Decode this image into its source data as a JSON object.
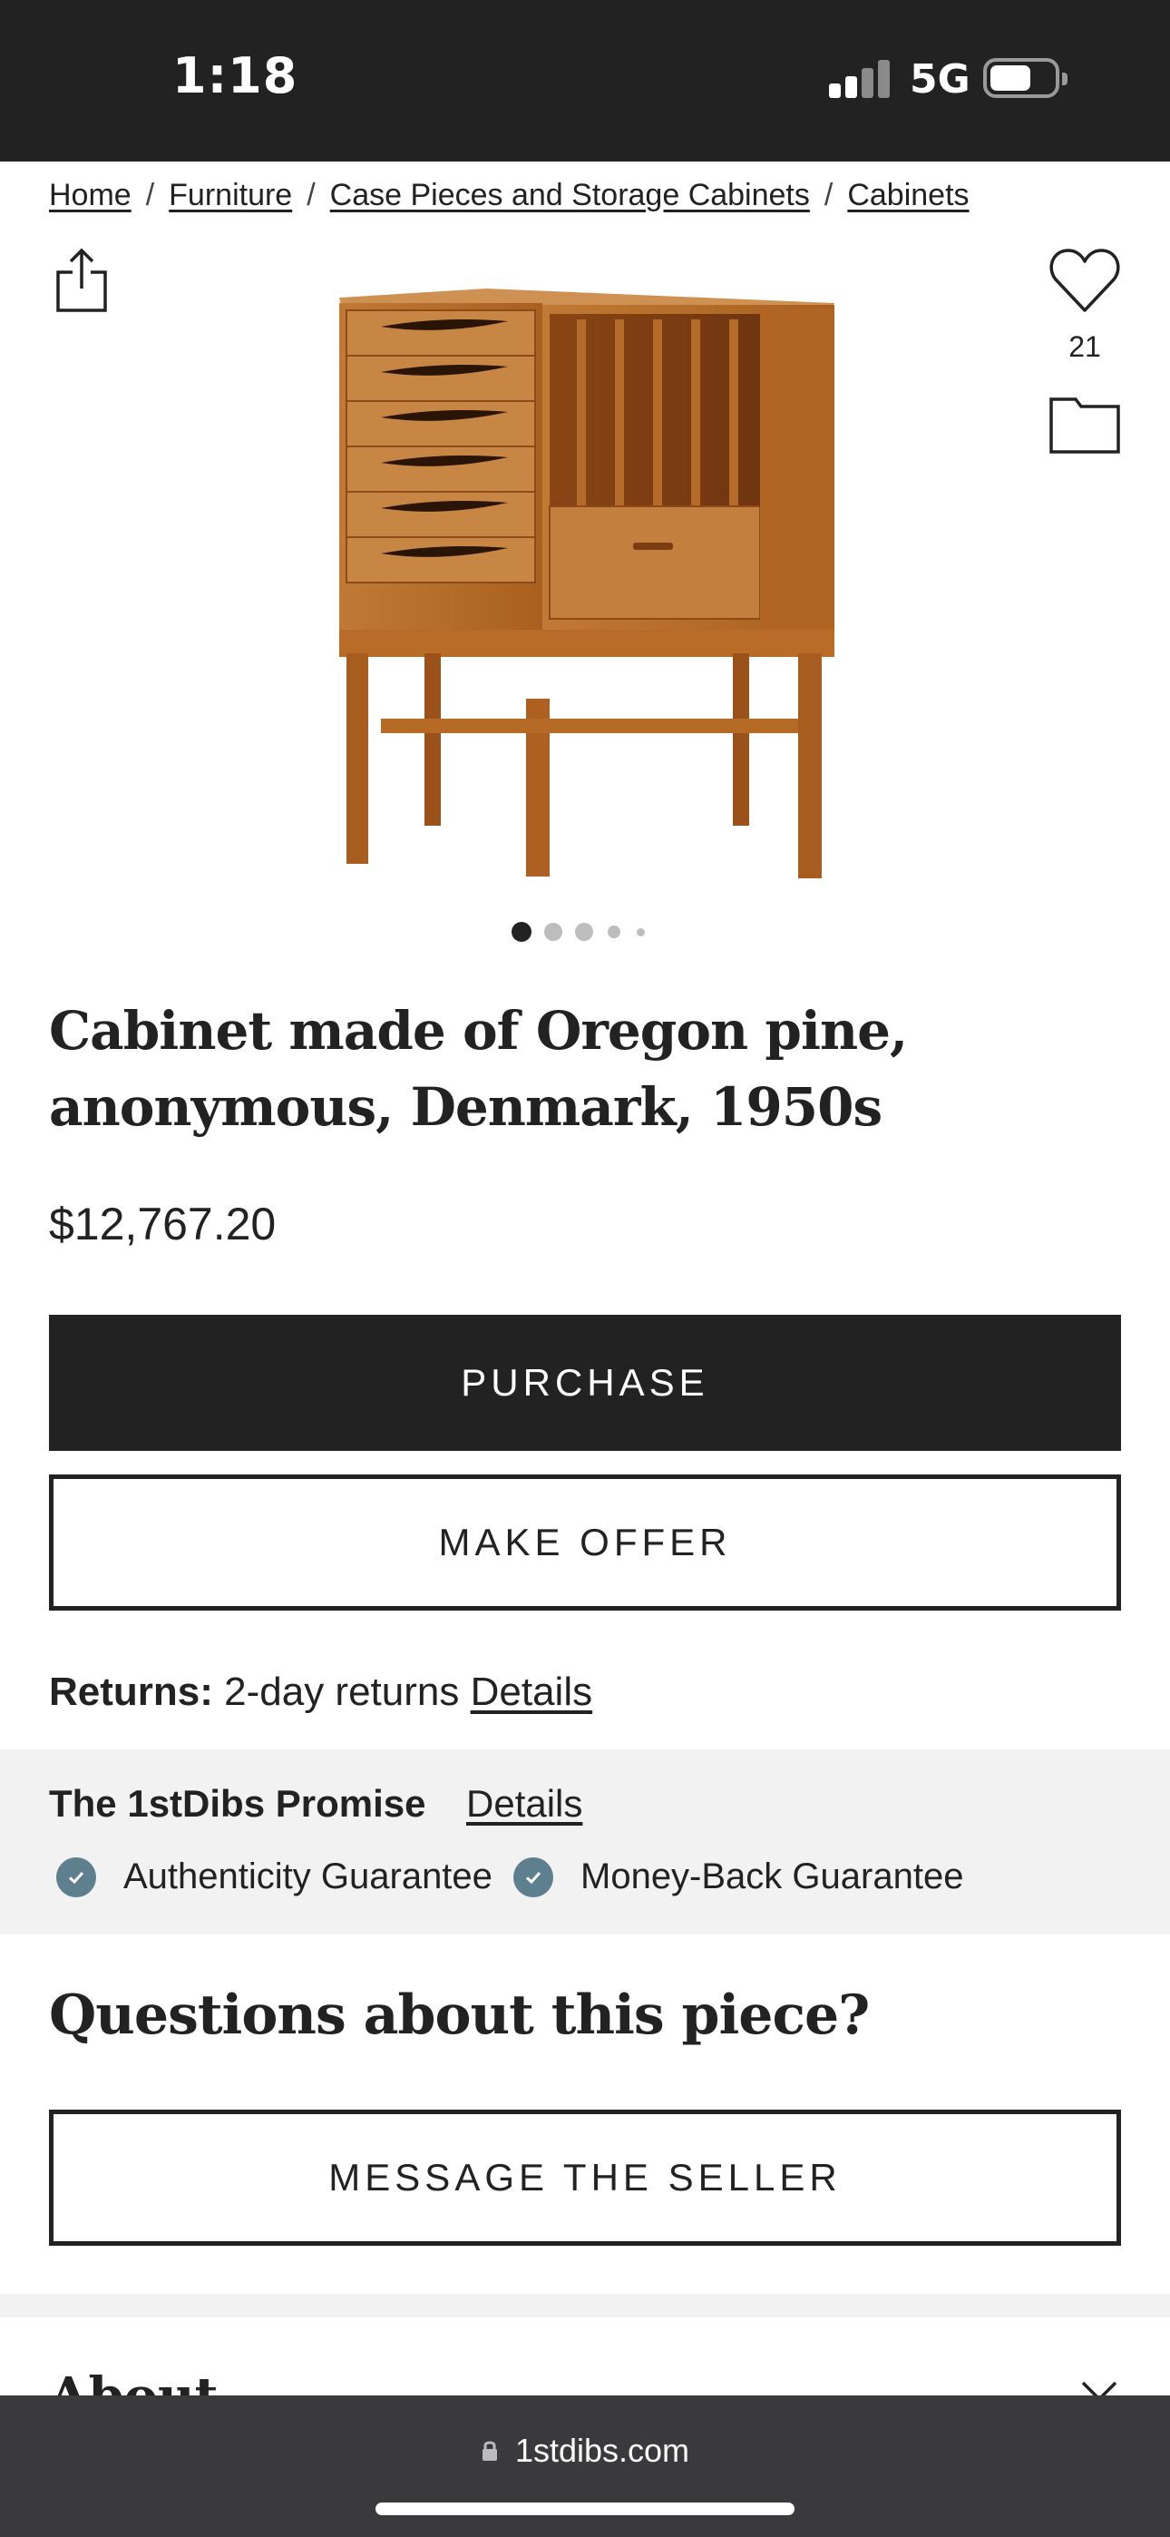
{
  "status_bar": {
    "time": "1:18",
    "network": "5G"
  },
  "breadcrumb": {
    "items": [
      "Home",
      "Furniture",
      "Case Pieces and Storage Cabinets",
      "Cabinets"
    ],
    "separator": "/"
  },
  "gallery": {
    "favorite_count": "21",
    "slide_count": 5,
    "active_slide": 1
  },
  "product": {
    "title": "Cabinet made of Oregon pine, anonymous, Denmark, 1950s",
    "price": "$12,767.20"
  },
  "actions": {
    "purchase_label": "PURCHASE",
    "offer_label": "MAKE OFFER",
    "message_label": "MESSAGE THE SELLER"
  },
  "returns": {
    "label": "Returns:",
    "text": "2-day returns",
    "details_label": "Details"
  },
  "promise": {
    "title": "The 1stDibs Promise",
    "details_label": "Details",
    "guarantees": [
      "Authenticity Guarantee",
      "Money-Back Guarantee"
    ]
  },
  "questions": {
    "heading": "Questions about this piece?"
  },
  "about": {
    "heading": "About"
  },
  "browser": {
    "url": "1stdibs.com"
  },
  "colors": {
    "dark": "#222222",
    "check_badge": "#5e7f8e",
    "promise_bg": "#f2f2f2",
    "wood": "#b46a2a"
  },
  "icons": [
    "share-icon",
    "heart-icon",
    "folder-icon",
    "check-icon",
    "chevron-down-icon",
    "lock-icon"
  ]
}
